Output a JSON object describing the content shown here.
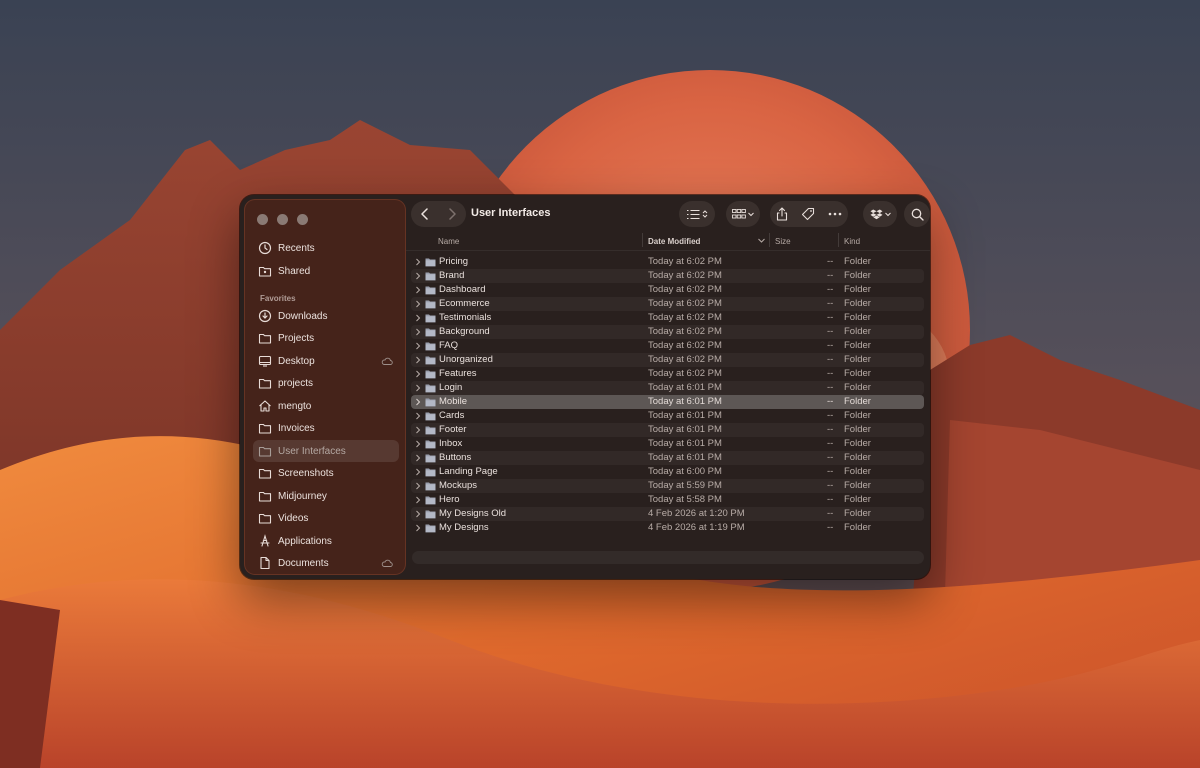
{
  "window": {
    "title": "User Interfaces"
  },
  "sidebar": {
    "top_items": [
      {
        "label": "Recents",
        "icon": "clock-icon"
      },
      {
        "label": "Shared",
        "icon": "shared-folder-icon"
      }
    ],
    "section_label": "Favorites",
    "favorites": [
      {
        "label": "Downloads",
        "icon": "download-icon"
      },
      {
        "label": "Projects",
        "icon": "folder-icon"
      },
      {
        "label": "Desktop",
        "icon": "desktop-icon",
        "cloud": true
      },
      {
        "label": "projects",
        "icon": "folder-icon"
      },
      {
        "label": "mengto",
        "icon": "home-icon"
      },
      {
        "label": "Invoices",
        "icon": "folder-icon"
      },
      {
        "label": "User Interfaces",
        "icon": "folder-icon",
        "active": true
      },
      {
        "label": "Screenshots",
        "icon": "folder-icon"
      },
      {
        "label": "Midjourney",
        "icon": "folder-icon"
      },
      {
        "label": "Videos",
        "icon": "folder-icon"
      },
      {
        "label": "Applications",
        "icon": "applications-icon"
      },
      {
        "label": "Documents",
        "icon": "document-icon",
        "cloud": true
      }
    ]
  },
  "columns": {
    "name": "Name",
    "date": "Date Modified",
    "size": "Size",
    "kind": "Kind"
  },
  "files": [
    {
      "name": "Pricing",
      "date": "Today at 6:02 PM",
      "size": "--",
      "kind": "Folder"
    },
    {
      "name": "Brand",
      "date": "Today at 6:02 PM",
      "size": "--",
      "kind": "Folder"
    },
    {
      "name": "Dashboard",
      "date": "Today at 6:02 PM",
      "size": "--",
      "kind": "Folder"
    },
    {
      "name": "Ecommerce",
      "date": "Today at 6:02 PM",
      "size": "--",
      "kind": "Folder"
    },
    {
      "name": "Testimonials",
      "date": "Today at 6:02 PM",
      "size": "--",
      "kind": "Folder"
    },
    {
      "name": "Background",
      "date": "Today at 6:02 PM",
      "size": "--",
      "kind": "Folder"
    },
    {
      "name": "FAQ",
      "date": "Today at 6:02 PM",
      "size": "--",
      "kind": "Folder"
    },
    {
      "name": "Unorganized",
      "date": "Today at 6:02 PM",
      "size": "--",
      "kind": "Folder"
    },
    {
      "name": "Features",
      "date": "Today at 6:02 PM",
      "size": "--",
      "kind": "Folder"
    },
    {
      "name": "Login",
      "date": "Today at 6:01 PM",
      "size": "--",
      "kind": "Folder"
    },
    {
      "name": "Mobile",
      "date": "Today at 6:01 PM",
      "size": "--",
      "kind": "Folder",
      "selected": true
    },
    {
      "name": "Cards",
      "date": "Today at 6:01 PM",
      "size": "--",
      "kind": "Folder"
    },
    {
      "name": "Footer",
      "date": "Today at 6:01 PM",
      "size": "--",
      "kind": "Folder"
    },
    {
      "name": "Inbox",
      "date": "Today at 6:01 PM",
      "size": "--",
      "kind": "Folder"
    },
    {
      "name": "Buttons",
      "date": "Today at 6:01 PM",
      "size": "--",
      "kind": "Folder"
    },
    {
      "name": "Landing Page",
      "date": "Today at 6:00 PM",
      "size": "--",
      "kind": "Folder"
    },
    {
      "name": "Mockups",
      "date": "Today at 5:59 PM",
      "size": "--",
      "kind": "Folder"
    },
    {
      "name": "Hero",
      "date": "Today at 5:58 PM",
      "size": "--",
      "kind": "Folder"
    },
    {
      "name": "My Designs Old",
      "date": "4 Feb 2026 at 1:20 PM",
      "size": "--",
      "kind": "Folder"
    },
    {
      "name": "My Designs",
      "date": "4 Feb 2026 at 1:19 PM",
      "size": "--",
      "kind": "Folder"
    }
  ],
  "toolbar_icons": [
    "chevron-left-icon",
    "chevron-right-icon",
    "list-view-icon",
    "group-icon",
    "share-icon",
    "tag-icon",
    "more-icon",
    "dropbox-icon",
    "search-icon"
  ],
  "colors": {
    "window_bg": "#29201e",
    "sidebar_bg": "#5c2618",
    "selection": "#5d5755",
    "folder": "#9a9fae"
  }
}
